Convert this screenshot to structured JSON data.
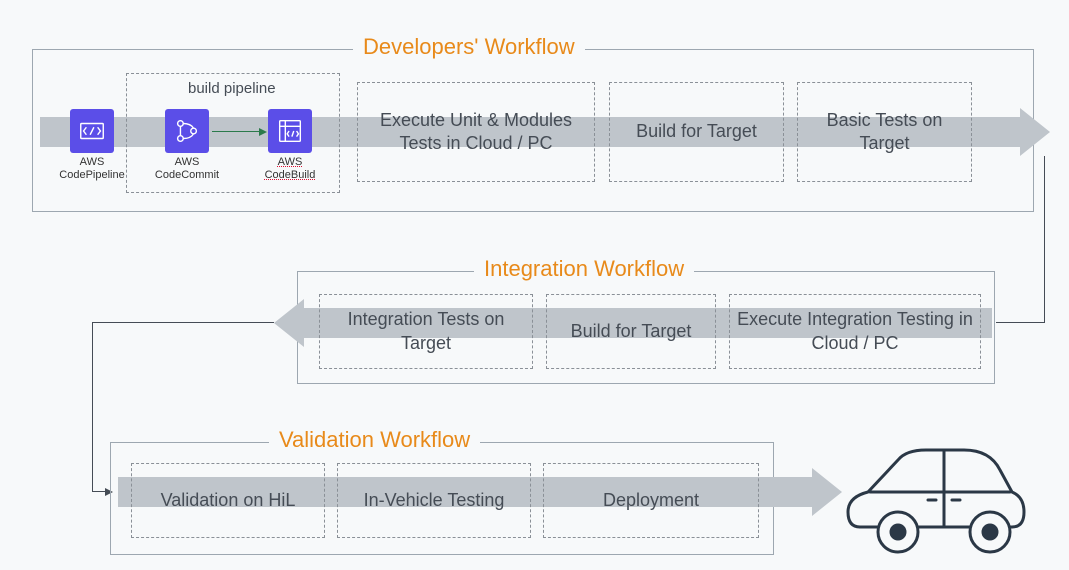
{
  "workflows": {
    "dev": {
      "title": "Developers' Workflow",
      "pipeline_label": "build pipeline",
      "services": {
        "codepipeline": "AWS\nCodePipeline",
        "codecommit": "AWS\nCodeCommit",
        "codebuild": "AWS\nCodeBuild"
      },
      "steps": {
        "unit": "Execute Unit & Modules Tests in Cloud / PC",
        "build": "Build for Target",
        "basic": "Basic Tests on Target"
      }
    },
    "integration": {
      "title": "Integration Workflow",
      "steps": {
        "int_tests": "Integration Tests on Target",
        "build": "Build for Target",
        "exec": "Execute Integration Testing in Cloud / PC"
      }
    },
    "validation": {
      "title": "Validation Workflow",
      "steps": {
        "hil": "Validation on HiL",
        "vehicle": "In-Vehicle Testing",
        "deploy": "Deployment"
      }
    }
  }
}
